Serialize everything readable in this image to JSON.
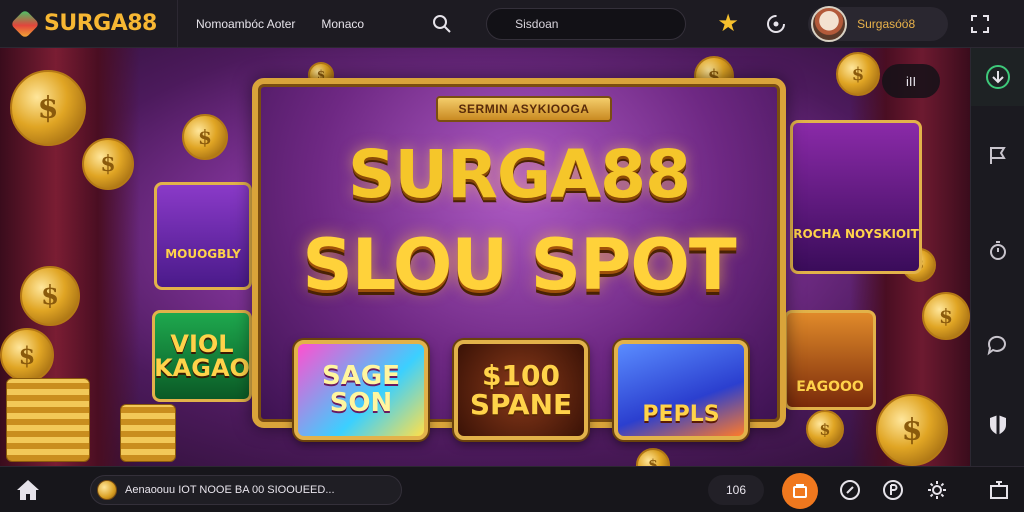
{
  "header": {
    "brand": "SURGA88",
    "nav": [
      "Nomoambóc Aoter",
      "Monaco"
    ],
    "search_value": "Sisdoan",
    "username": "Surgasóö8"
  },
  "banner": {
    "ribbon": "SERMIN ASYKIOOGA",
    "title_line1": "SURGA88",
    "title_line2": "SLOU SPOT",
    "tiles": [
      {
        "label": "SAGE SON"
      },
      {
        "label": "$100 SPANE"
      },
      {
        "label": "PEPLS"
      }
    ],
    "side_tiles": [
      {
        "label": "MOUOGBLY"
      },
      {
        "label": "VIOL KAGAO"
      },
      {
        "label": "ROCHA NOYSKIOIT"
      },
      {
        "label": "EAGOOO"
      }
    ],
    "corner_badge": "іІІ"
  },
  "footer": {
    "ticker_text": "Aenaoouu IOT  NOOE BA 00 SIOOUEED...",
    "count": "106"
  },
  "colors": {
    "brand_gold": "#f7b733",
    "accent_orange": "#f0781e",
    "star_yellow": "#f6c02d"
  },
  "icons": [
    "logo-icon",
    "search-icon",
    "star-icon",
    "refresh-icon",
    "expand-icon",
    "home-icon",
    "coin-icon",
    "wallet-icon",
    "chat-icon",
    "history-icon",
    "settings-icon",
    "screen-icon"
  ]
}
